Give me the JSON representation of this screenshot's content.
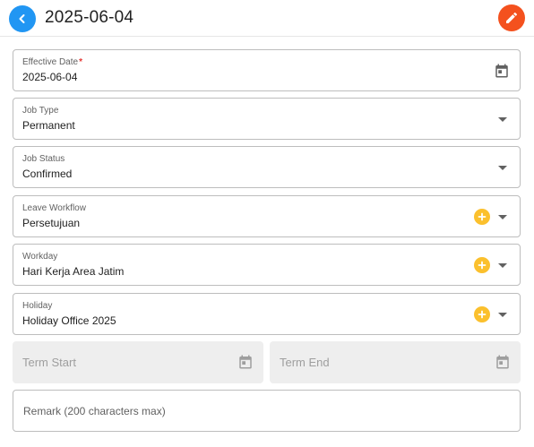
{
  "header": {
    "title": "2025-06-04",
    "back_icon": "chevron-left-icon",
    "edit_icon": "pencil-icon"
  },
  "fields": {
    "effective_date": {
      "label": "Effective Date",
      "required_mark": "*",
      "value": "2025-06-04",
      "icon": "calendar-icon"
    },
    "job_type": {
      "label": "Job Type",
      "value": "Permanent"
    },
    "job_status": {
      "label": "Job Status",
      "value": "Confirmed"
    },
    "leave_workflow": {
      "label": "Leave Workflow",
      "value": "Persetujuan"
    },
    "workday": {
      "label": "Workday",
      "value": "Hari Kerja Area Jatim"
    },
    "holiday": {
      "label": "Holiday",
      "value": "Holiday Office 2025"
    }
  },
  "term": {
    "start_placeholder": "Term Start",
    "end_placeholder": "Term End"
  },
  "remark": {
    "placeholder": "Remark (200 characters max)"
  },
  "colors": {
    "back_button": "#2196f3",
    "edit_button": "#f4511e",
    "add_button": "#fbc02d",
    "required": "#e53935",
    "disabled_bg": "#eeeeee"
  }
}
